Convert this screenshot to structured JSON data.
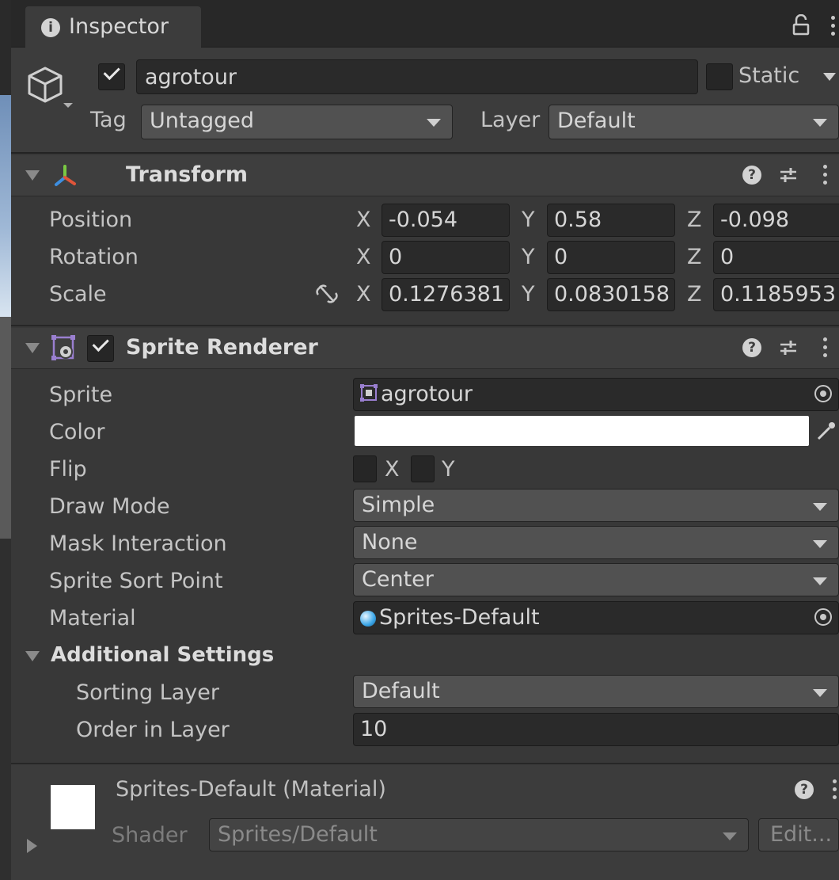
{
  "window": {
    "tab_title": "Inspector"
  },
  "header": {
    "enabled": true,
    "object_name": "agrotour",
    "static_label": "Static",
    "tag_label": "Tag",
    "tag_value": "Untagged",
    "layer_label": "Layer",
    "layer_value": "Default"
  },
  "transform": {
    "title": "Transform",
    "rows": [
      {
        "label": "Position",
        "x": "-0.054",
        "y": "0.58",
        "z": "-0.098"
      },
      {
        "label": "Rotation",
        "x": "0",
        "y": "0",
        "z": "0"
      },
      {
        "label": "Scale",
        "x": "0.1276381",
        "y": "0.0830158",
        "z": "0.1185953"
      }
    ],
    "axis_x": "X",
    "axis_y": "Y",
    "axis_z": "Z"
  },
  "sprite_renderer": {
    "title": "Sprite Renderer",
    "enabled": true,
    "sprite_label": "Sprite",
    "sprite_value": "agrotour",
    "color_label": "Color",
    "color_value": "#ffffff",
    "flip_label": "Flip",
    "flip_x": "X",
    "flip_y": "Y",
    "draw_mode_label": "Draw Mode",
    "draw_mode_value": "Simple",
    "mask_label": "Mask Interaction",
    "mask_value": "None",
    "sort_point_label": "Sprite Sort Point",
    "sort_point_value": "Center",
    "material_label": "Material",
    "material_value": "Sprites-Default",
    "additional_title": "Additional Settings",
    "sorting_layer_label": "Sorting Layer",
    "sorting_layer_value": "Default",
    "order_label": "Order in Layer",
    "order_value": "10"
  },
  "material": {
    "title": "Sprites-Default (Material)",
    "shader_label": "Shader",
    "shader_value": "Sprites/Default",
    "edit_label": "Edit..."
  },
  "icons": [
    "info-icon",
    "lock-icon",
    "kebab-menu-icon",
    "gameobject-cube-icon",
    "transform-axes-icon",
    "sprite-renderer-icon",
    "help-icon",
    "presets-icon",
    "unlink-scale-icon",
    "sprite-asset-icon",
    "object-picker-icon",
    "eyedropper-icon",
    "material-sphere-icon"
  ]
}
